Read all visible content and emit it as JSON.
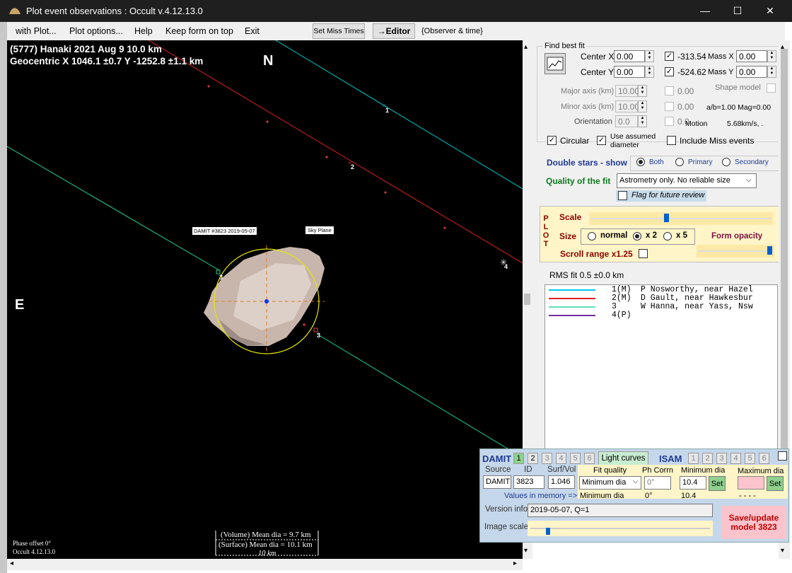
{
  "window": {
    "title": "Plot event observations : Occult v.4.12.13.0",
    "controls": {
      "minimize": "—",
      "maximize": "☐",
      "close": "✕"
    }
  },
  "menu": {
    "items": [
      "with Plot...",
      "Plot options...",
      "Help",
      "Keep form on top",
      "Exit"
    ],
    "set_miss_times": "Set Miss Times",
    "editor": "→Editor",
    "observer_time": "{Observer & time}"
  },
  "plot": {
    "header_line1": "(5777) Hanaki  2021 Aug 9   10.0 km",
    "header_line2": "Geocentric X  1046.1 ±0.7  Y -1252.8 ±1.1 km",
    "north": "N",
    "east": "E",
    "damit_tag": "DAMIT #3823 2019-05-07",
    "sky_plane_tag": "Sky Plane",
    "chord_labels": [
      "1",
      "2",
      "3",
      "4",
      "3"
    ],
    "phase_offset": "Phase offset 0°",
    "occult_version": "Occult 4.12.13.0",
    "volume_dia": "(Volume) Mean dia = 9.7 km",
    "surface_dia": "(Surface) Mean dia = 10.1 km",
    "scale_bar": "10 km",
    "colors": {
      "background": "#000000",
      "chord1": "#00c8c8",
      "chord2": "#e02020",
      "chord3": "#20d090",
      "fit_circle": "#e6e600"
    }
  },
  "fit": {
    "group_title": "Find best fit",
    "center_x": {
      "label": "Center X",
      "value": "0.00",
      "checked_value": "-313.54"
    },
    "center_y": {
      "label": "Center Y",
      "value": "0.00",
      "checked_value": "-524.62"
    },
    "mass_x": {
      "label": "Mass X",
      "value": "0.00"
    },
    "mass_y": {
      "label": "Mass Y",
      "value": "0.00"
    },
    "major_axis": {
      "label": "Major axis (km)",
      "value": "10.00",
      "checked_value": "0.00"
    },
    "minor_axis": {
      "label": "Minor axis (km)",
      "value": "10.00",
      "checked_value": "0.00"
    },
    "orientation": {
      "label": "Orientation",
      "value": "0.0",
      "checked_value": "0.0"
    },
    "shape_model": "Shape model",
    "ab_mag": "a/b=1.00  Mag=0.00",
    "motion_label": "Motion",
    "motion_value": "5.68km/s, .",
    "circular": "Circular",
    "use_assumed_diameter_1": "Use assumed",
    "use_assumed_diameter_2": "diameter",
    "include_miss": "Include Miss events"
  },
  "double_stars": {
    "label": "Double stars - show",
    "options": [
      "Both",
      "Primary",
      "Secondary"
    ]
  },
  "quality": {
    "label": "Quality of the fit",
    "selected": "Astrometry only. No reliable size",
    "flag": "Flag for future review"
  },
  "plot_opts": {
    "side_label": [
      "P",
      "L",
      "O",
      "T"
    ],
    "scale": "Scale",
    "size": "Size",
    "size_options": [
      "normal",
      "x 2",
      "x 5"
    ],
    "form_opacity": "Form opacity",
    "scroll_range": "Scroll range x1.25"
  },
  "rms": "RMS fit 0.5 ±0.0 km",
  "observers": [
    {
      "id": "1(M)",
      "name": "P Nosworthy, near Hazel",
      "color": "#00c8e8"
    },
    {
      "id": "2(M)",
      "name": "D Gault, near Hawkesbur",
      "color": "#e02020"
    },
    {
      "id": "3",
      "name": "W Hanna, near Yass, Nsw",
      "color": "#60e0c0"
    },
    {
      "id": "4(P)",
      "name": "",
      "color": "#7030a0"
    }
  ],
  "damit": {
    "title": "DAMIT",
    "tabs": [
      "1",
      "2",
      "3",
      "4",
      "5",
      "6"
    ],
    "light_curves": "Light curves",
    "isam": "ISAM",
    "isam_tabs": [
      "1",
      "2",
      "3",
      "4",
      "5",
      "6"
    ],
    "source_label": "Source",
    "source": "DAMIT",
    "id_label": "ID",
    "id": "3823",
    "surfvol_label": "Surf/Vol",
    "surfvol": "1.046",
    "fit_quality_label": "Fit quality",
    "fit_quality": "Minimum dia",
    "ph_corrn_label": "Ph Corrn",
    "ph_corrn": "0°",
    "min_dia_label": "Minimum dia",
    "min_dia": "10.4",
    "max_dia_label": "Maximum dia",
    "set": "Set",
    "values_in_memory": "Values in memory =>",
    "mem_fit": "Minimum dia",
    "mem_ph": "0°",
    "mem_min": "10.4",
    "mem_max": "- - - -",
    "version_label": "Version info",
    "version": "2019-05-07, Q=1",
    "image_scale": "Image scale",
    "save": "Save/update model 3823"
  }
}
